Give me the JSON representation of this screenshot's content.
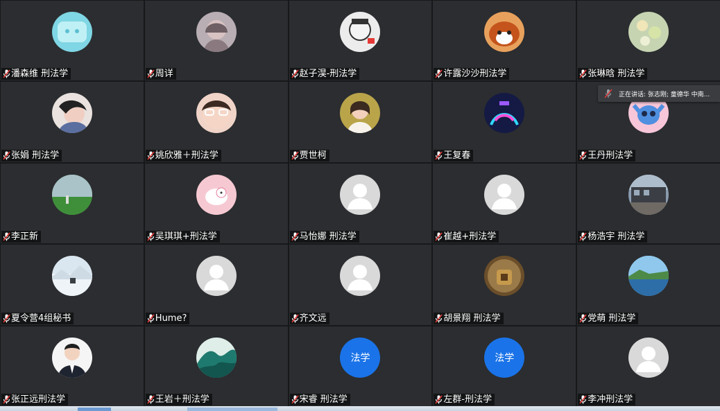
{
  "speaking": {
    "text": "正在讲话: 张志刚; 童德华  中南..."
  },
  "participants": [
    {
      "name": "潘森维 刑法学",
      "avatar": "pixel-sky"
    },
    {
      "name": "周详",
      "avatar": "drawn-girl"
    },
    {
      "name": "赵子淏-刑法学",
      "avatar": "sketch"
    },
    {
      "name": "许露沙沙刑法学",
      "avatar": "red-panda"
    },
    {
      "name": "张琳晗 刑法学",
      "avatar": "flowers"
    },
    {
      "name": "张娟  刑法学",
      "avatar": "girl-face"
    },
    {
      "name": "姚欣雅＋刑法学",
      "avatar": "baby"
    },
    {
      "name": "贾世柯",
      "avatar": "girl-yellow"
    },
    {
      "name": "王复春",
      "avatar": "neon"
    },
    {
      "name": "王丹刑法学",
      "avatar": "stitch"
    },
    {
      "name": "李正新",
      "avatar": "field"
    },
    {
      "name": "吴琪琪+刑法学",
      "avatar": "pink-sheep"
    },
    {
      "name": "马怡娜 刑法学",
      "avatar": "default"
    },
    {
      "name": "崔越+刑法学",
      "avatar": "default"
    },
    {
      "name": "杨浩宇 刑法学",
      "avatar": "train"
    },
    {
      "name": "夏令营4组秘书",
      "avatar": "snow"
    },
    {
      "name": "Hume?",
      "avatar": "default"
    },
    {
      "name": "齐文远",
      "avatar": "default"
    },
    {
      "name": "胡景翔 刑法学",
      "avatar": "cave"
    },
    {
      "name": "党萌 刑法学",
      "avatar": "island"
    },
    {
      "name": "张正远刑法学",
      "avatar": "man-suit"
    },
    {
      "name": "王岩＋刑法学",
      "avatar": "wave"
    },
    {
      "name": "宋睿 刑法学",
      "avatar": "text",
      "avatar_text": "法学"
    },
    {
      "name": "左群-刑法学",
      "avatar": "text",
      "avatar_text": "法学"
    },
    {
      "name": "李冲刑法学",
      "avatar": "default"
    }
  ]
}
